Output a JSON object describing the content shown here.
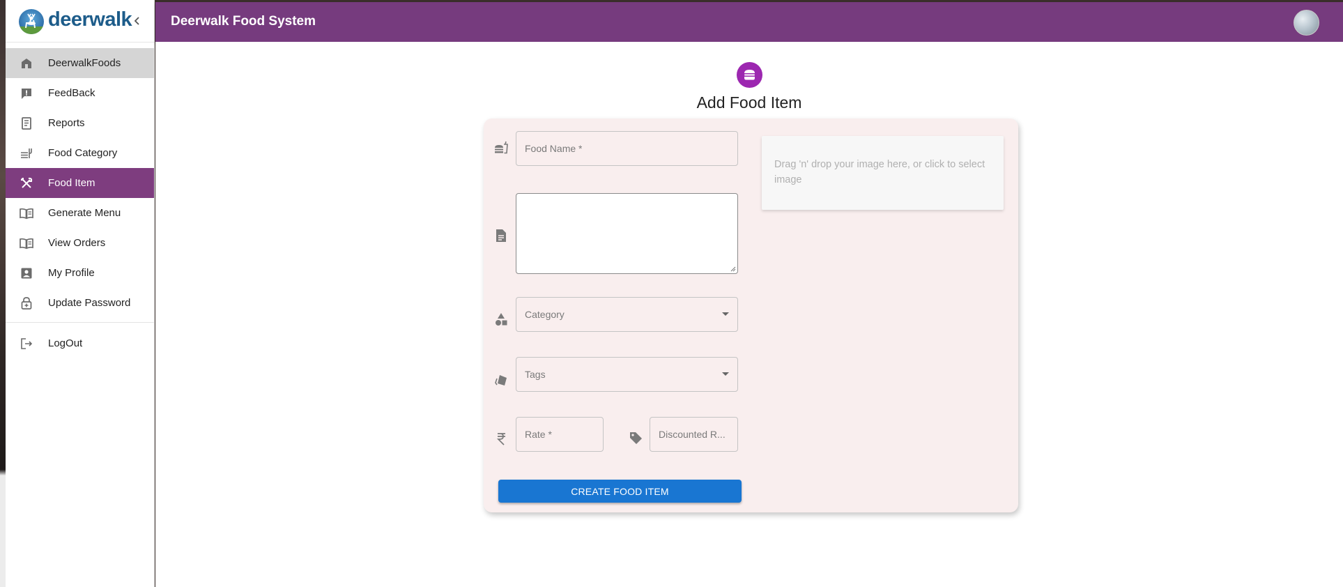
{
  "brand": {
    "logo_text": "deerwalk"
  },
  "header": {
    "app_title": "Deerwalk Food System"
  },
  "sidebar": {
    "items": [
      {
        "label": "DeerwalkFoods",
        "icon": "store-icon"
      },
      {
        "label": "FeedBack",
        "icon": "feedback-icon"
      },
      {
        "label": "Reports",
        "icon": "receipt-icon"
      },
      {
        "label": "Food Category",
        "icon": "food-bank-icon"
      },
      {
        "label": "Food Item",
        "icon": "restaurant-icon"
      },
      {
        "label": "Generate Menu",
        "icon": "menu-book-icon"
      },
      {
        "label": "View Orders",
        "icon": "menu-book-icon"
      },
      {
        "label": "My Profile",
        "icon": "account-box-icon"
      },
      {
        "label": "Update Password",
        "icon": "lock-icon"
      }
    ],
    "logout": {
      "label": "LogOut",
      "icon": "logout-icon"
    },
    "active_item": "Food Item",
    "hover_item": "DeerwalkFoods"
  },
  "form": {
    "title": "Add Food Item",
    "food_name_placeholder": "Food Name *",
    "description_value": "",
    "category_placeholder": "Category",
    "tags_placeholder": "Tags",
    "rate_placeholder": "Rate *",
    "discounted_rate_placeholder": "Discounted R...",
    "dropzone_text": "Drag 'n' drop your image here, or click to select image",
    "submit_label": "CREATE FOOD ITEM"
  },
  "colors": {
    "header_bg": "#763b7e",
    "active_nav_bg": "#7e3d7f",
    "hover_nav_bg": "#d5d5d5",
    "page_icon_bg": "#9c27b0",
    "card_bg": "#f9eeee",
    "button_bg": "#1976d2",
    "brand_text": "#1d5c8a"
  }
}
